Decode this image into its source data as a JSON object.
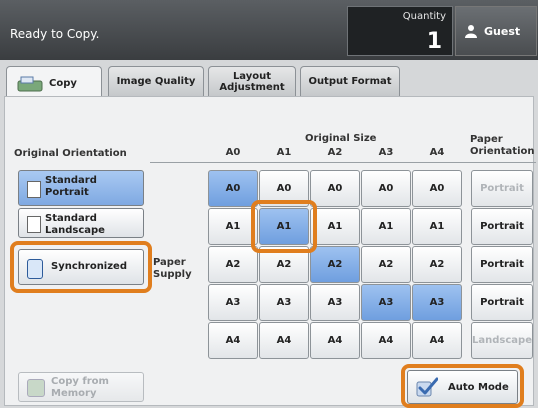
{
  "status": {
    "text": "Ready to Copy."
  },
  "quantity": {
    "label": "Quantity",
    "value": "1"
  },
  "user": {
    "label": "Guest"
  },
  "tabs": [
    {
      "label": "Copy",
      "active": true
    },
    {
      "label": "Image Quality",
      "active": false
    },
    {
      "label": "Layout\nAdjustment",
      "active": false
    },
    {
      "label": "Output Format",
      "active": false
    }
  ],
  "orientation": {
    "heading": "Original Orientation",
    "options": [
      {
        "label": "Standard\nPortrait",
        "selected": true
      },
      {
        "label": "Standard\nLandscape",
        "selected": false
      }
    ],
    "synchronized_label": "Synchronized"
  },
  "size_table": {
    "heading": "Original Size",
    "paper_supply_label": "Paper\nSupply",
    "columns": [
      "A0",
      "A1",
      "A2",
      "A3",
      "A4"
    ],
    "rows": [
      [
        "A0",
        "A0",
        "A0",
        "A0",
        "A0"
      ],
      [
        "A1",
        "A1",
        "A1",
        "A1",
        "A1"
      ],
      [
        "A2",
        "A2",
        "A2",
        "A2",
        "A2"
      ],
      [
        "A3",
        "A3",
        "A3",
        "A3",
        "A3"
      ],
      [
        "A4",
        "A4",
        "A4",
        "A4",
        "A4"
      ]
    ],
    "selected_cells": [
      [
        0,
        0
      ],
      [
        1,
        1
      ],
      [
        2,
        2
      ],
      [
        3,
        3
      ],
      [
        3,
        4
      ]
    ]
  },
  "paper_orientation": {
    "heading": "Paper\nOrientation",
    "buttons": [
      {
        "label": "Portrait",
        "enabled": false
      },
      {
        "label": "Portrait",
        "enabled": true
      },
      {
        "label": "Portrait",
        "enabled": true
      },
      {
        "label": "Portrait",
        "enabled": true
      },
      {
        "label": "Landscape",
        "enabled": false
      }
    ]
  },
  "bottom": {
    "copy_from_memory": "Copy from\nMemory",
    "auto_mode": "Auto Mode"
  },
  "colors": {
    "highlight": "#e07e1e",
    "selected_blue": "#7fa9e2",
    "topbar": "#3a3d40"
  }
}
